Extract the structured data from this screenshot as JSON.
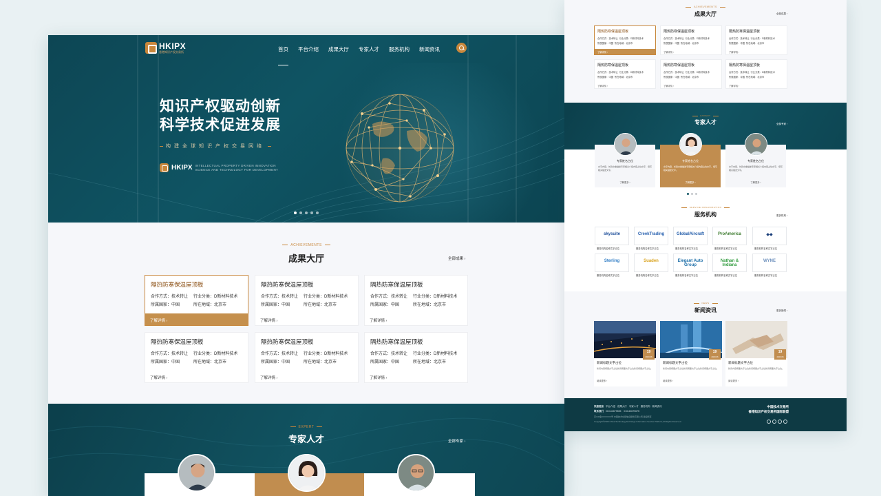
{
  "nav": {
    "logo_text": "HKIPX",
    "logo_sub": "香港知识产权交易所",
    "items": [
      "首页",
      "平台介绍",
      "成果大厅",
      "专家人才",
      "服务机构",
      "新闻资讯"
    ]
  },
  "hero": {
    "title_line1": "知识产权驱动创新",
    "title_line2": "科学技术促进发展",
    "subtitle": "构建全球知识产权交易网络",
    "brand": "HKIPX",
    "brand_en_line1": "INTELLECTUAL PROPERTY DRIVEN INNOVATION",
    "brand_en_line2": "SCIENCE AND TECHNOLOGY FOR DEVELOPMENT",
    "slides": 5,
    "active_slide": 1
  },
  "achievements": {
    "tag": "ACHIEVEMENTS",
    "title": "成果大厅",
    "more": "全部成果",
    "cards": [
      {
        "title": "隔热防寒保温屋顶板",
        "coop": "合作方式：技术转让",
        "industry": "行业分类：D新材料技术",
        "country": "所属国家：中国",
        "region": "所在地域：北京市",
        "more": "了解详情"
      },
      {
        "title": "隔热防寒保温屋顶板",
        "coop": "合作方式：技术转让",
        "industry": "行业分类：D新材料技术",
        "country": "所属国家：中国",
        "region": "所在地域：北京市",
        "more": "了解详情"
      },
      {
        "title": "隔热防寒保温屋顶板",
        "coop": "合作方式：技术转让",
        "industry": "行业分类：D新材料技术",
        "country": "所属国家：中国",
        "region": "所在地域：北京市",
        "more": "了解详情"
      },
      {
        "title": "隔热防寒保温屋顶板",
        "coop": "合作方式：技术转让",
        "industry": "行业分类：D新材料技术",
        "country": "所属国家：中国",
        "region": "所在地域：北京市",
        "more": "了解详情"
      },
      {
        "title": "隔热防寒保温屋顶板",
        "coop": "合作方式：技术转让",
        "industry": "行业分类：D新材料技术",
        "country": "所属国家：中国",
        "region": "所在地域：北京市",
        "more": "了解详情"
      },
      {
        "title": "隔热防寒保温屋顶板",
        "coop": "合作方式：技术转让",
        "industry": "行业分类：D新材料技术",
        "country": "所属国家：中国",
        "region": "所在地域：北京市",
        "more": "了解详情"
      }
    ]
  },
  "experts": {
    "tag": "EXPERT",
    "title": "专家人才",
    "more": "全部专家",
    "cards": [
      {
        "name": "专家姓名占位",
        "desc": "文字内容，长篇文章描述专家相关介绍内容占位文字，填写相关描述文字。",
        "more": "了解更多"
      },
      {
        "name": "专家姓名占位",
        "desc": "文字内容，长篇文章描述专家相关介绍内容占位文字，填写相关描述文字。",
        "more": "了解更多"
      },
      {
        "name": "专家姓名占位",
        "desc": "文字内容，长篇文章描述专家相关介绍内容占位文字，填写相关描述文字。",
        "more": "了解更多"
      }
    ]
  },
  "organizations": {
    "tag": "SERVICE ORGANIZATION",
    "title": "服务机构",
    "more": "更多机构",
    "items": [
      {
        "logo": "skysuite",
        "color": "#1d4e9a",
        "caption": "服务机构名称文字占位"
      },
      {
        "logo": "CreekTrading",
        "color": "#2a62b0",
        "caption": "服务机构名称文字占位"
      },
      {
        "logo": "GlobalAircraft",
        "color": "#1f5aa8",
        "caption": "服务机构名称文字占位"
      },
      {
        "logo": "ProAmerica",
        "color": "#3b7a2d",
        "caption": "服务机构名称文字占位"
      },
      {
        "logo": "◆◆",
        "color": "#1b3f7a",
        "caption": "服务机构名称文字占位"
      },
      {
        "logo": "Sterling",
        "color": "#2d7bc4",
        "caption": "服务机构名称文字占位"
      },
      {
        "logo": "Suaden",
        "color": "#d9a21c",
        "caption": "服务机构名称文字占位"
      },
      {
        "logo": "Elegant Auto Group",
        "color": "#1c6ea8",
        "caption": "服务机构名称文字占位"
      },
      {
        "logo": "Nathan & Indiana",
        "color": "#2f9a3c",
        "caption": "服务机构名称文字占位"
      },
      {
        "logo": "WYNE",
        "color": "#6c8fbc",
        "caption": "服务机构名称文字占位"
      }
    ]
  },
  "news": {
    "tag": "NEWS",
    "title": "新闻资讯",
    "more": "更多新闻",
    "items": [
      {
        "title": "新闻标题文字占位",
        "day": "19",
        "ym": "2020.06",
        "desc": "新闻内容概要文字占位新闻概要文字占位新闻概要文字占位。",
        "more": "阅读更多"
      },
      {
        "title": "新闻标题文字占位",
        "day": "19",
        "ym": "2020.06",
        "desc": "新闻内容概要文字占位新闻概要文字占位新闻概要文字占位。",
        "more": "阅读更多"
      },
      {
        "title": "新闻标题文字占位",
        "day": "19",
        "ym": "2020.06",
        "desc": "新闻内容概要文字占位新闻概要文字占位新闻概要文字占位。",
        "more": "阅读更多"
      }
    ]
  },
  "footer": {
    "links_label": "快捷链接",
    "links": [
      "平台介绍",
      "成果大厅",
      "专家人才",
      "服务机构",
      "新闻资讯"
    ],
    "contact_label": "联系我们",
    "tel1": "010-62679505",
    "tel2": "010-62679675",
    "copyright1": "京ICP备XXXXXXX号 中国技术交易信息服务有限公司 版权所有",
    "copyright2": "Copyright©2020 China Technology Exchange Information Service Platform,All Rights Reserved.",
    "right_line1": "中国技术交易所",
    "right_line2": "香港知识产权交易所国际联盟"
  },
  "colors": {
    "brand_teal": "#0f5463",
    "accent_gold": "#c8873c",
    "background": "#e9f1f3"
  }
}
